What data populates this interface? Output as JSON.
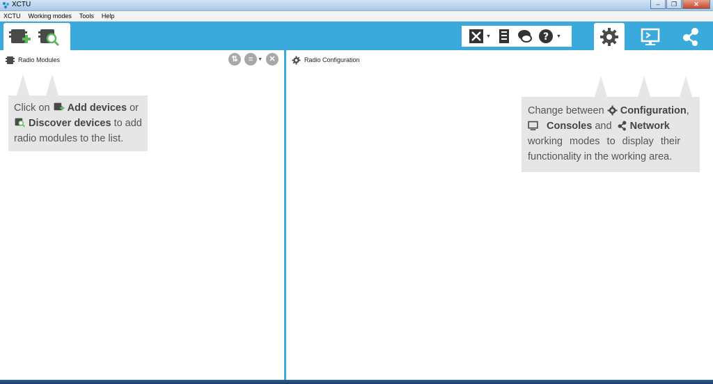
{
  "window": {
    "title": "XCTU",
    "minimize_icon": "minimize-icon",
    "maximize_icon": "restore-icon",
    "close_icon": "close-icon"
  },
  "menu": {
    "items": [
      "XCTU",
      "Working modes",
      "Tools",
      "Help"
    ]
  },
  "toolbar": {
    "left_icons": [
      "add-devices-icon",
      "discover-devices-icon"
    ],
    "tools_icons": [
      "tools-icon",
      "frames-icon",
      "xbee-chat-icon",
      "help-icon"
    ],
    "modes": [
      {
        "name": "configuration-mode-icon",
        "active": true
      },
      {
        "name": "consoles-mode-icon",
        "active": false
      },
      {
        "name": "network-mode-icon",
        "active": false
      }
    ],
    "accent_color": "#3aaadc"
  },
  "left_panel": {
    "title": "Radio Modules",
    "tool_icons": [
      "sort-icon",
      "filter-icon",
      "remove-icon"
    ]
  },
  "right_panel": {
    "title": "Radio Configuration"
  },
  "hint_left": {
    "line1_pre": "Click on",
    "add_devices": "Add devices",
    "line1_post": "or",
    "discover_devices": "Discover devices",
    "line2_post": "to add",
    "line3": "radio modules to the list."
  },
  "hint_right": {
    "line1_pre": "Change between",
    "configuration": "Configuration",
    "line1_post": ",",
    "consoles": "Consoles",
    "line2_mid": "and",
    "network": "Network",
    "line3": "working modes to display their",
    "line4": "functionality in the working area."
  }
}
